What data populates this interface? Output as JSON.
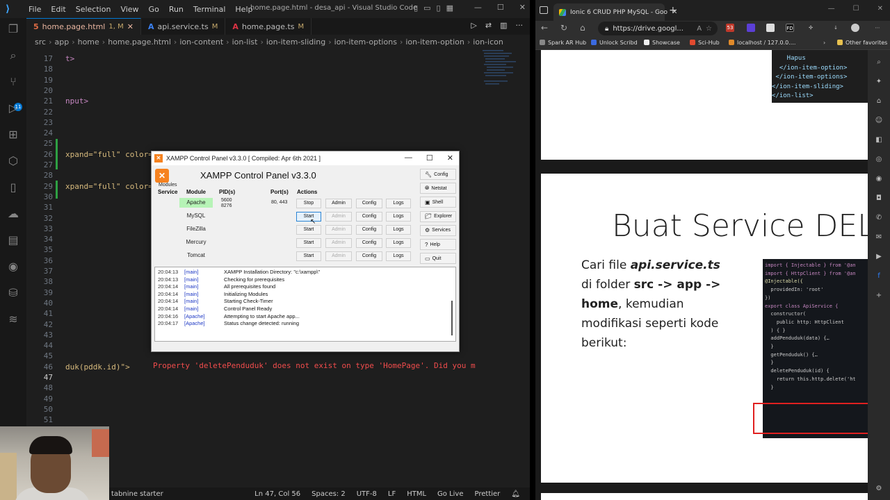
{
  "vscode": {
    "menu": [
      "File",
      "Edit",
      "Selection",
      "View",
      "Go",
      "Run",
      "Terminal",
      "Help"
    ],
    "window_title": "home.page.html - desa_api - Visual Studio Code",
    "activity_badge": "11",
    "tabs": [
      {
        "label": "home.page.html",
        "status": "1, M",
        "icon": "html-file-icon"
      },
      {
        "label": "api.service.ts",
        "status": "M",
        "icon": "typescript-file-icon"
      },
      {
        "label": "home.page.ts",
        "status": "M",
        "icon": "angular-file-icon"
      }
    ],
    "breadcrumb": [
      "src",
      "app",
      "home",
      "home.page.html",
      "ion-content",
      "ion-list",
      "ion-item-sliding",
      "ion-item-options",
      "ion-item-option",
      "ion-icon"
    ],
    "lines": [
      {
        "n": "17",
        "text": "t>",
        "cls": "tag"
      },
      {
        "n": "18",
        "text": "",
        "cls": ""
      },
      {
        "n": "19",
        "text": "",
        "cls": ""
      },
      {
        "n": "20",
        "text": "",
        "cls": ""
      },
      {
        "n": "21",
        "text": "nput>",
        "cls": "tag"
      },
      {
        "n": "22",
        "text": "",
        "cls": ""
      },
      {
        "n": "23",
        "text": "",
        "cls": ""
      },
      {
        "n": "24",
        "text": "",
        "cls": ""
      },
      {
        "n": "25",
        "text": "",
        "cls": ""
      },
      {
        "n": "26",
        "text": "xpand=\"full\" color=",
        "cls": "attr"
      },
      {
        "n": "27",
        "text": "",
        "cls": ""
      },
      {
        "n": "28",
        "text": "",
        "cls": ""
      },
      {
        "n": "29",
        "text": "xpand=\"full\" color=",
        "cls": "attr"
      },
      {
        "n": "30",
        "text": "",
        "cls": ""
      },
      {
        "n": "31",
        "text": "",
        "cls": ""
      },
      {
        "n": "32",
        "text": "",
        "cls": ""
      },
      {
        "n": "33",
        "text": "",
        "cls": ""
      },
      {
        "n": "34",
        "text": "",
        "cls": ""
      },
      {
        "n": "35",
        "text": "",
        "cls": ""
      },
      {
        "n": "36",
        "text": "",
        "cls": ""
      },
      {
        "n": "37",
        "text": "",
        "cls": ""
      },
      {
        "n": "38",
        "text": "",
        "cls": ""
      },
      {
        "n": "39",
        "text": "",
        "cls": ""
      },
      {
        "n": "40",
        "text": "",
        "cls": ""
      },
      {
        "n": "41",
        "text": "",
        "cls": ""
      },
      {
        "n": "42",
        "text": "",
        "cls": ""
      },
      {
        "n": "43",
        "text": "",
        "cls": ""
      },
      {
        "n": "44",
        "text": "",
        "cls": ""
      },
      {
        "n": "45",
        "text": "",
        "cls": ""
      },
      {
        "n": "46",
        "text": "duk(pddk.id)\">",
        "cls": "attr"
      },
      {
        "n": "47",
        "text": "",
        "cls": ""
      },
      {
        "n": "48",
        "text": "",
        "cls": ""
      },
      {
        "n": "49",
        "text": "",
        "cls": ""
      },
      {
        "n": "50",
        "text": "",
        "cls": ""
      },
      {
        "n": "51",
        "text": "",
        "cls": ""
      }
    ],
    "error_hint": "Property 'deletePenduduk' does not exist on type 'HomePage'. Did you m",
    "status": {
      "left": "tabnine starter",
      "position": "Ln 47, Col 56",
      "spaces": "Spaces: 2",
      "encoding": "UTF-8",
      "eol": "LF",
      "language": "HTML",
      "golive": "Go Live",
      "prettier": "Prettier"
    }
  },
  "xampp": {
    "window_title": "XAMPP Control Panel v3.3.0   [ Compiled: Apr 6th 2021 ]",
    "heading": "XAMPP Control Panel v3.3.0",
    "modules_label": "Modules",
    "headers": {
      "service": "Service",
      "module": "Module",
      "pid": "PID(s)",
      "port": "Port(s)",
      "actions": "Actions"
    },
    "rows": [
      {
        "module": "Apache",
        "pid": [
          "5600",
          "8276"
        ],
        "port": "80, 443",
        "action": "Stop",
        "running": true
      },
      {
        "module": "MySQL",
        "pid": [],
        "port": "",
        "action": "Start",
        "running": false
      },
      {
        "module": "FileZilla",
        "pid": [],
        "port": "",
        "action": "Start",
        "running": false
      },
      {
        "module": "Mercury",
        "pid": [],
        "port": "",
        "action": "Start",
        "running": false
      },
      {
        "module": "Tomcat",
        "pid": [],
        "port": "",
        "action": "Start",
        "running": false
      }
    ],
    "admin_label": "Admin",
    "config_label": "Config",
    "logs_label": "Logs",
    "side": [
      {
        "label": "Config",
        "icon": "wrench-icon"
      },
      {
        "label": "Netstat",
        "icon": "globe-icon"
      },
      {
        "label": "Shell",
        "icon": "terminal-icon"
      },
      {
        "label": "Explorer",
        "icon": "folder-icon"
      },
      {
        "label": "Services",
        "icon": "services-icon"
      },
      {
        "label": "Help",
        "icon": "help-icon"
      },
      {
        "label": "Quit",
        "icon": "quit-icon"
      }
    ],
    "log": [
      {
        "time": "20:04:13",
        "src": "[main]",
        "msg": "XAMPP Installation Directory: \"c:\\xampp\\\""
      },
      {
        "time": "20:04:13",
        "src": "[main]",
        "msg": "Checking for prerequisites"
      },
      {
        "time": "20:04:14",
        "src": "[main]",
        "msg": "All prerequisites found"
      },
      {
        "time": "20:04:14",
        "src": "[main]",
        "msg": "Initializing Modules"
      },
      {
        "time": "20:04:14",
        "src": "[main]",
        "msg": "Starting Check-Timer"
      },
      {
        "time": "20:04:14",
        "src": "[main]",
        "msg": "Control Panel Ready"
      },
      {
        "time": "20:04:16",
        "src": "[Apache]",
        "msg": "Attempting to start Apache app..."
      },
      {
        "time": "20:04:17",
        "src": "[Apache]",
        "msg": "Status change detected: running"
      }
    ]
  },
  "browser": {
    "tab_title": "Ionic 6 CRUD PHP MySQL - Goo",
    "url": "https://drive.googl...",
    "bookmarks": [
      "Spark AR Hub",
      "Unlock Scribd",
      "Showcase",
      "Sci-Hub",
      "localhost / 127.0.0...."
    ],
    "other_bookmarks": "Other favorites",
    "ext_badge": "53",
    "slide1_code": [
      "    Hapus",
      "  </ion-item-option>",
      " </ion-item-options>",
      "</ion-item-sliding>",
      "</ion-list>"
    ],
    "slide2": {
      "title": "Buat Service DEL",
      "text_parts": [
        "Cari file ",
        "api.service.ts",
        " di folder ",
        "src -> app -> home",
        ", kemudian modifikasi seperti kode berikut:"
      ],
      "code": [
        "import { Injectable } from '@an",
        "import { HttpClient } from '@an",
        "",
        "@Injectable({",
        "  providedIn: 'root'",
        "})",
        "export class ApiService {",
        "",
        "  constructor(",
        "    public http: HttpClient",
        "  ) { }",
        "",
        "  addPenduduk(data) {…",
        "  }",
        "",
        "  getPenduduk() {…",
        "  }",
        "",
        "  deletePenduduk(id) {",
        "    return this.http.delete('ht",
        "  }"
      ]
    }
  },
  "colors": {
    "vscode_bg": "#1e1e1e",
    "accent": "#0078d4",
    "error": "#f14c4c",
    "apache_running": "#b6f3b6",
    "highlight_box": "#e02020"
  }
}
